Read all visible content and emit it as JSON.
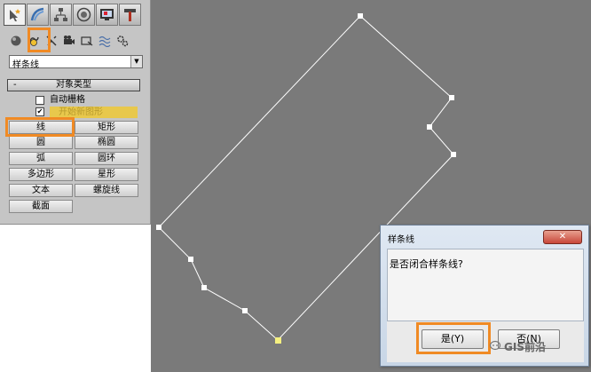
{
  "panel": {
    "tabs": [
      "create-tab",
      "modify-tab",
      "hierarchy-tab",
      "motion-tab",
      "display-tab",
      "utilities-tab"
    ],
    "categories": [
      "geometry-icon",
      "shapes-icon",
      "lights-icon",
      "cameras-icon",
      "helpers-icon",
      "space-warps-icon",
      "systems-icon"
    ],
    "dropdown_value": "样条线",
    "rollout_title": "对象类型",
    "rollout_toggle": "-",
    "auto_grid_label": "自动栅格",
    "auto_grid_checked": "",
    "start_new_shape_label": "开始新图形",
    "start_new_shape_checked": "✔",
    "buttons": {
      "line": "线",
      "rectangle": "矩形",
      "circle": "圆",
      "ellipse": "椭圆",
      "arc": "弧",
      "donut": "圆环",
      "ngon": "多边形",
      "star": "星形",
      "text": "文本",
      "helix": "螺旋线",
      "section": "截面"
    }
  },
  "dialog": {
    "title": "样条线",
    "close_label": "✕",
    "message": "是否闭合样条线?",
    "yes_label": "是(Y)",
    "no_label": "否(N)"
  },
  "watermark": "GIS前沿",
  "colors": {
    "highlight": "#f08a24",
    "viewport_bg": "#7a7a7a",
    "spline_line": "#ffffff",
    "first_vertex": "#f5f080"
  }
}
